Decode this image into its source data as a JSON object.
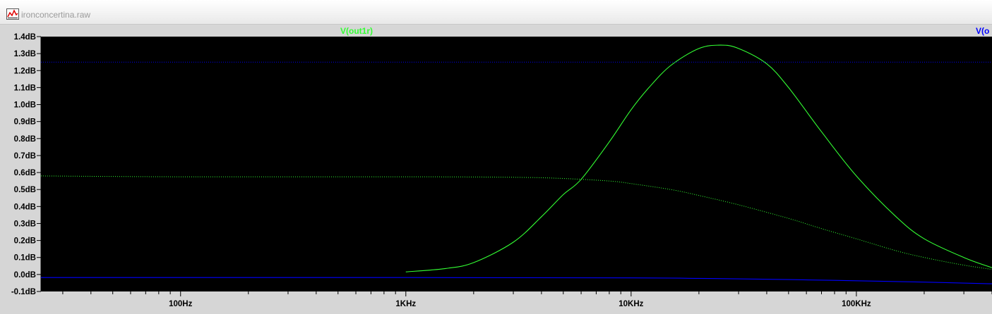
{
  "window": {
    "title": "ironconcertina.raw",
    "icon": "waveform-icon"
  },
  "colors": {
    "background": "#000000",
    "frame": "#d6d6d6",
    "trace_green": "#33ff33",
    "trace_blue": "#0000ff"
  },
  "chart_data": {
    "type": "line",
    "x_scale": "log",
    "y_unit": "dB",
    "xlim_hz": [
      24,
      400000
    ],
    "ylim": [
      -0.1,
      1.4
    ],
    "y_ticks": [
      1.4,
      1.3,
      1.2,
      1.1,
      1.0,
      0.9,
      0.8,
      0.7,
      0.6,
      0.5,
      0.4,
      0.3,
      0.2,
      0.1,
      0.0,
      -0.1
    ],
    "y_tick_labels": [
      "1.4dB",
      "1.3dB",
      "1.2dB",
      "1.1dB",
      "1.0dB",
      "0.9dB",
      "0.8dB",
      "0.7dB",
      "0.6dB",
      "0.5dB",
      "0.4dB",
      "0.3dB",
      "0.2dB",
      "0.1dB",
      "0.0dB",
      "-0.1dB"
    ],
    "x_ticks_hz": [
      100,
      1000,
      10000,
      100000
    ],
    "x_tick_labels": [
      "100Hz",
      "1KHz",
      "10KHz",
      "100KHz"
    ],
    "series": [
      {
        "name": "V(out1r)",
        "color": "#33ff33",
        "style": "solid",
        "x_hz": [
          1000,
          1500,
          2000,
          3000,
          4000,
          5000,
          6000,
          8000,
          10000,
          12000,
          15000,
          20000,
          25000,
          30000,
          40000,
          50000,
          70000,
          100000,
          150000,
          200000,
          300000,
          400000
        ],
        "values": [
          0.015,
          0.035,
          0.07,
          0.19,
          0.34,
          0.47,
          0.56,
          0.78,
          0.97,
          1.1,
          1.23,
          1.33,
          1.35,
          1.33,
          1.24,
          1.1,
          0.84,
          0.58,
          0.34,
          0.21,
          0.1,
          0.04
        ]
      },
      {
        "name": "",
        "color": "#33ff33",
        "style": "dotted",
        "x_hz": [
          24,
          100,
          1000,
          3000,
          5000,
          8000,
          10000,
          15000,
          20000,
          30000,
          50000,
          70000,
          100000,
          150000,
          200000,
          300000,
          400000
        ],
        "values": [
          0.58,
          0.575,
          0.575,
          0.572,
          0.565,
          0.55,
          0.535,
          0.5,
          0.465,
          0.41,
          0.33,
          0.27,
          0.21,
          0.14,
          0.1,
          0.055,
          0.03
        ]
      },
      {
        "name": "V(o",
        "color": "#0000ff",
        "style": "solid",
        "x_hz": [
          24,
          1000,
          10000,
          20000,
          50000,
          100000,
          200000,
          400000
        ],
        "values": [
          -0.018,
          -0.018,
          -0.02,
          -0.023,
          -0.03,
          -0.037,
          -0.045,
          -0.055
        ]
      },
      {
        "name": "",
        "color": "#0000ff",
        "style": "dotted",
        "x_hz": [
          24,
          400000
        ],
        "values": [
          1.25,
          1.25
        ]
      }
    ]
  }
}
